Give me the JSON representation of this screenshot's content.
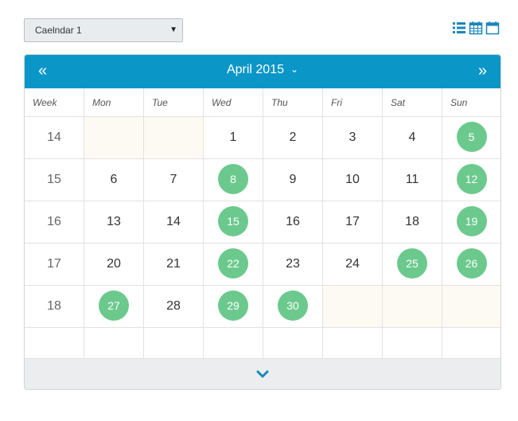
{
  "calendar_select": {
    "value": "Caelndar 1"
  },
  "view_icons": [
    "list-view-icon",
    "month-grid-view-icon",
    "calendar-view-icon"
  ],
  "header": {
    "prev_label": "«",
    "title": "April 2015",
    "next_label": "»"
  },
  "weekday_headers": [
    "Week",
    "Mon",
    "Tue",
    "Wed",
    "Thu",
    "Fri",
    "Sat",
    "Sun"
  ],
  "weeks": [
    {
      "week": "14",
      "days": [
        {
          "label": "",
          "pad": true
        },
        {
          "label": "",
          "pad": true
        },
        {
          "label": "1"
        },
        {
          "label": "2"
        },
        {
          "label": "3"
        },
        {
          "label": "4"
        },
        {
          "label": "5",
          "event": true
        }
      ]
    },
    {
      "week": "15",
      "days": [
        {
          "label": "6"
        },
        {
          "label": "7"
        },
        {
          "label": "8",
          "event": true
        },
        {
          "label": "9"
        },
        {
          "label": "10"
        },
        {
          "label": "11"
        },
        {
          "label": "12",
          "event": true
        }
      ]
    },
    {
      "week": "16",
      "days": [
        {
          "label": "13"
        },
        {
          "label": "14"
        },
        {
          "label": "15",
          "event": true
        },
        {
          "label": "16"
        },
        {
          "label": "17"
        },
        {
          "label": "18"
        },
        {
          "label": "19",
          "event": true
        }
      ]
    },
    {
      "week": "17",
      "days": [
        {
          "label": "20"
        },
        {
          "label": "21"
        },
        {
          "label": "22",
          "event": true
        },
        {
          "label": "23"
        },
        {
          "label": "24"
        },
        {
          "label": "25",
          "event": true
        },
        {
          "label": "26",
          "event": true
        }
      ]
    },
    {
      "week": "18",
      "days": [
        {
          "label": "27",
          "event": true
        },
        {
          "label": "28"
        },
        {
          "label": "29",
          "event": true
        },
        {
          "label": "30",
          "event": true
        },
        {
          "label": "",
          "pad": true
        },
        {
          "label": "",
          "pad": true
        },
        {
          "label": "",
          "pad": true
        }
      ]
    }
  ],
  "colors": {
    "header": "#0b96c8",
    "event": "#6cc98d",
    "pad": "#fdfaf3",
    "footer": "#ecedee",
    "accent": "#1a86b8"
  }
}
